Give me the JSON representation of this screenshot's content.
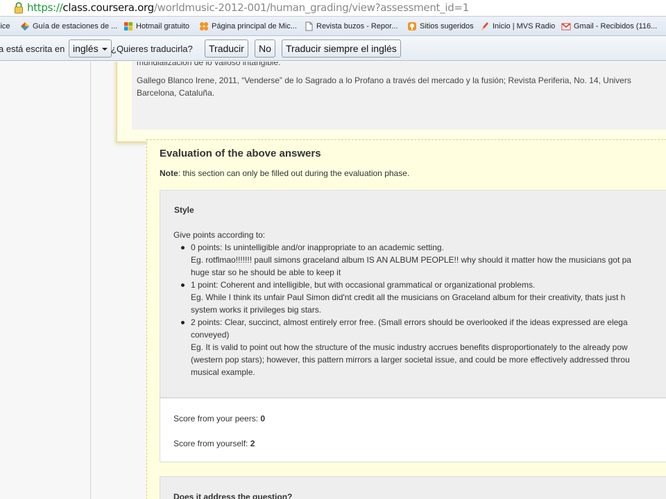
{
  "browser": {
    "url_scheme": "https://",
    "url_host": "class.coursera.org",
    "url_path": "/worldmusic-2012-001/human_grading/view?assessment_id=1",
    "bookmarks": [
      {
        "label": "lice",
        "icon": "partial-icon"
      },
      {
        "label": "Guía de estaciones de ...",
        "icon": "google-icon"
      },
      {
        "label": "Hotmail gratuito",
        "icon": "windows-flag-icon"
      },
      {
        "label": "Página principal de Mic...",
        "icon": "msn-icon"
      },
      {
        "label": "Revista buzos - Repor...",
        "icon": "page-icon"
      },
      {
        "label": "Sitios sugeridos",
        "icon": "orange-badge-icon"
      },
      {
        "label": "Inicio | MVS Radio",
        "icon": "pencil-icon"
      },
      {
        "label": "Gmail - Recibidos (116...",
        "icon": "gmail-icon"
      }
    ]
  },
  "translate_bar": {
    "prefix": "a está escrita en",
    "language": "inglés",
    "question": "¿Quieres traducirla?",
    "translate_button": "Traducir",
    "no_button": "No",
    "always_button": "Traducir siempre el inglés"
  },
  "previous_answer": {
    "line_1": "mundialización de lo valioso intangible.",
    "line_2": "Gallego Blanco Irene, 2011, “Venderse” de lo Sagrado a lo Profano a través del mercado y la fusión; Revista Periferia, No. 14, Univers",
    "line_3": "Barcelona, Cataluña."
  },
  "evaluation": {
    "title": "Evaluation of the above answers",
    "note_label": "Note",
    "note_text": ": this section can only be filled out during the evaluation phase.",
    "style": {
      "heading": "Style",
      "intro": "Give points according to:",
      "lines": [
        {
          "bullet": true,
          "text": "0 points:  Is unintelligible and/or inappropriate to an academic setting."
        },
        {
          "bullet": false,
          "text": "Eg. rotflmao!!!!!!! paull simons graceland album IS AN ALBUM PEOPLE!! why should it matter how the musicians got pa"
        },
        {
          "bullet": false,
          "text": "huge star so he should be able to keep it"
        },
        {
          "bullet": true,
          "text": "1 point: Coherent and intelligible, but with occasional grammatical or organizational problems."
        },
        {
          "bullet": false,
          "text": "Eg. While I think its unfair Paul Simon did'nt credit all the musicians on Graceland album for their creativity, thats just h"
        },
        {
          "bullet": false,
          "text": "system works it privileges big stars."
        },
        {
          "bullet": true,
          "text": "2 points: Clear, succinct, almost entirely error free.  (Small errors should be overlooked if the ideas expressed are elega"
        },
        {
          "bullet": false,
          "text": "conveyed)"
        },
        {
          "bullet": false,
          "text": "Eg. It is valid to point out how the structure of the music industry accrues benefits disproportionately to the already pow"
        },
        {
          "bullet": false,
          "text": "(western pop stars); however, this pattern mirrors a larger societal issue, and could be more effectively addressed throu"
        },
        {
          "bullet": false,
          "text": "musical example."
        }
      ]
    },
    "scores": {
      "peers_label": "Score from your peers: ",
      "peers_value": "0",
      "self_label": "Score from yourself: ",
      "self_value": "2"
    },
    "next_heading": "Does it address the question?"
  }
}
